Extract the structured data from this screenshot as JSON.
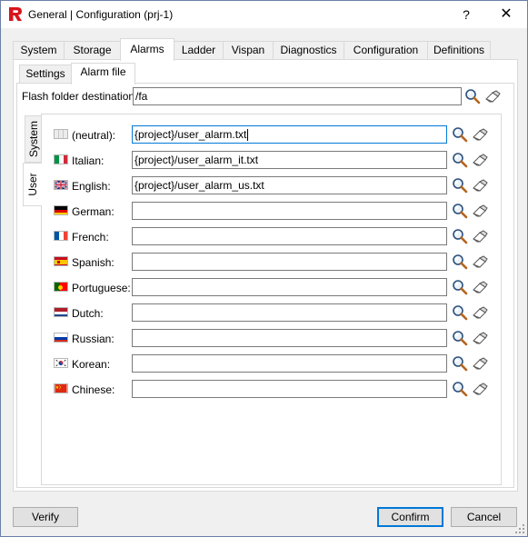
{
  "window": {
    "title": "General | Configuration (prj-1)",
    "help_glyph": "?",
    "close_glyph": "✕"
  },
  "tabs": [
    {
      "label": "System"
    },
    {
      "label": "Storage"
    },
    {
      "label": "Alarms"
    },
    {
      "label": "Ladder"
    },
    {
      "label": "Vispan"
    },
    {
      "label": "Diagnostics"
    },
    {
      "label": "Configuration"
    },
    {
      "label": "Definitions"
    }
  ],
  "active_tab": "Alarms",
  "subtabs": [
    {
      "label": "Settings"
    },
    {
      "label": "Alarm file"
    }
  ],
  "active_subtab": "Alarm file",
  "flash": {
    "label": "Flash folder destination:",
    "value": "/fa"
  },
  "side_tabs": [
    {
      "label": "System"
    },
    {
      "label": "User"
    }
  ],
  "active_side_tab": "User",
  "languages": [
    {
      "name": "(neutral):",
      "value": "{project}/user_alarm.txt",
      "flag": "neutral-flag-icon",
      "focused": true
    },
    {
      "name": "Italian:",
      "value": "{project}/user_alarm_it.txt",
      "flag": "italy-flag-icon"
    },
    {
      "name": "English:",
      "value": "{project}/user_alarm_us.txt",
      "flag": "uk-flag-icon"
    },
    {
      "name": "German:",
      "value": "",
      "flag": "germany-flag-icon"
    },
    {
      "name": "French:",
      "value": "",
      "flag": "france-flag-icon"
    },
    {
      "name": "Spanish:",
      "value": "",
      "flag": "spain-flag-icon"
    },
    {
      "name": "Portuguese:",
      "value": "",
      "flag": "portugal-flag-icon"
    },
    {
      "name": "Dutch:",
      "value": "",
      "flag": "netherlands-flag-icon"
    },
    {
      "name": "Russian:",
      "value": "",
      "flag": "russia-flag-icon"
    },
    {
      "name": "Korean:",
      "value": "",
      "flag": "korea-flag-icon"
    },
    {
      "name": "Chinese:",
      "value": "",
      "flag": "china-flag-icon"
    }
  ],
  "buttons": {
    "verify": "Verify",
    "confirm": "Confirm",
    "cancel": "Cancel"
  },
  "icons": {
    "browse": "magnifier-browse-icon",
    "clear": "eraser-clear-icon"
  },
  "colors": {
    "brand_red": "#d8141c",
    "focus_blue": "#0078d7"
  }
}
